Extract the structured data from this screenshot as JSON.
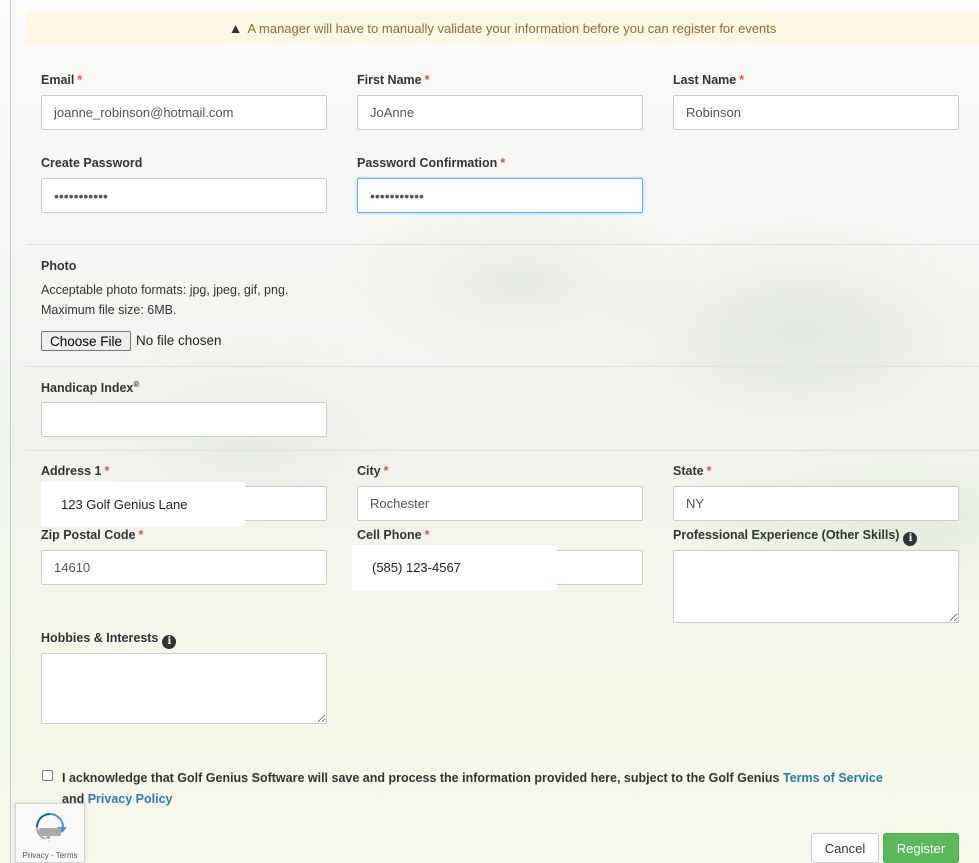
{
  "alert": {
    "icon": "warning-icon",
    "text": "A manager will have to manually validate your information before you can register for events"
  },
  "email": {
    "label": "Email",
    "value": "joanne_robinson@hotmail.com"
  },
  "first_name": {
    "label": "First Name",
    "value": "JoAnne"
  },
  "last_name": {
    "label": "Last Name",
    "value": "Robinson"
  },
  "create_password": {
    "label": "Create Password",
    "value": "•••••••••••"
  },
  "password_confirmation": {
    "label": "Password Confirmation",
    "value": "•••••••••••"
  },
  "photo": {
    "label": "Photo",
    "formats_text": "Acceptable photo formats: jpg, jpeg, gif, png.",
    "size_text": "Maximum file size: 6MB.",
    "choose_button": "Choose File",
    "status": "No file chosen"
  },
  "handicap": {
    "label": "Handicap Index",
    "mark": "®",
    "value": ""
  },
  "address1": {
    "label": "Address 1",
    "value": "123 Golf Genius Lane"
  },
  "city": {
    "label": "City",
    "value": "Rochester"
  },
  "state": {
    "label": "State",
    "value": "NY"
  },
  "zip": {
    "label": "Zip Postal Code",
    "value": "14610"
  },
  "cell_phone": {
    "label": "Cell Phone",
    "value": "(585) 123-4567"
  },
  "experience": {
    "label": "Professional Experience (Other Skills)",
    "value": ""
  },
  "hobbies": {
    "label": "Hobbies & Interests",
    "value": ""
  },
  "required_mark": "*",
  "info_glyph": "i",
  "acknowledge": {
    "text_part1": "I acknowledge that Golf Genius Software will save and process the information provided here, subject to the Golf Genius",
    "terms_link": "Terms of Service",
    "and": "and",
    "privacy_link": "Privacy Policy",
    "checked": false
  },
  "recaptcha": {
    "terms": "Privacy - Terms"
  },
  "buttons": {
    "cancel": "Cancel",
    "register": "Register"
  },
  "colors": {
    "required": "#d9534f",
    "link": "#2a7ab8",
    "register_bg": "#5cb85c",
    "alert_bg": "#fcf8e3"
  }
}
